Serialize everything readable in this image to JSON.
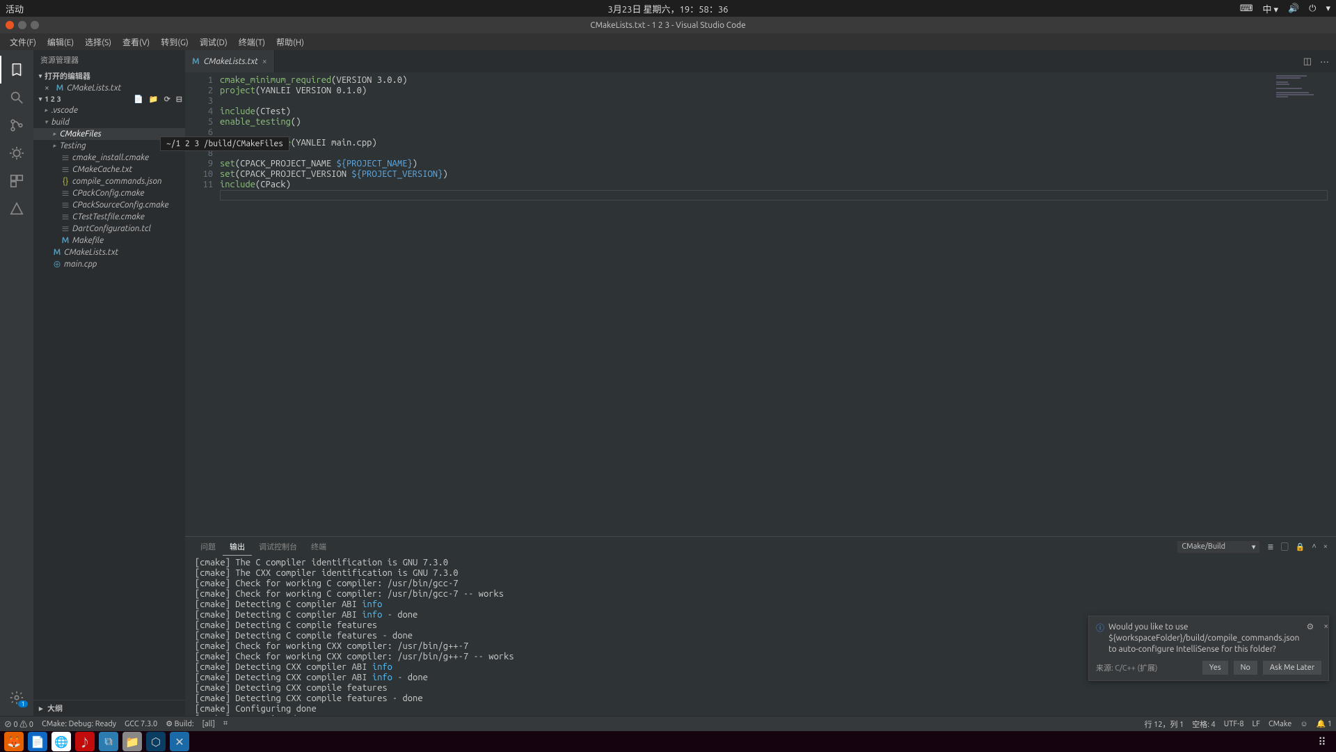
{
  "system": {
    "activities": "活动",
    "datetime": "3月23日 星期六，19：58：36",
    "ime": "中 ▾"
  },
  "window": {
    "title": "CMakeLists.txt - 1 2 3 - Visual Studio Code"
  },
  "menubar": [
    "文件(F)",
    "编辑(E)",
    "选择(S)",
    "查看(V)",
    "转到(G)",
    "调试(D)",
    "终端(T)",
    "帮助(H)"
  ],
  "sidebar": {
    "title": "资源管理器",
    "openEditorsLabel": "打开的编辑器",
    "openEditors": [
      {
        "icon": "M",
        "name": "CMakeLists.txt"
      }
    ],
    "projectLabel": "1 2 3",
    "tree": [
      {
        "depth": 0,
        "chevron": "▸",
        "icon": "folder",
        "label": ".vscode"
      },
      {
        "depth": 0,
        "chevron": "▾",
        "icon": "folder",
        "label": "build"
      },
      {
        "depth": 1,
        "chevron": "▸",
        "icon": "folder",
        "label": "CMakeFiles",
        "selected": true
      },
      {
        "depth": 1,
        "chevron": "▸",
        "icon": "folder",
        "label": "Testing"
      },
      {
        "depth": 1,
        "chevron": "",
        "icon": "file",
        "label": "cmake_install.cmake"
      },
      {
        "depth": 1,
        "chevron": "",
        "icon": "file",
        "label": "CMakeCache.txt"
      },
      {
        "depth": 1,
        "chevron": "",
        "icon": "json",
        "label": "compile_commands.json"
      },
      {
        "depth": 1,
        "chevron": "",
        "icon": "file",
        "label": "CPackConfig.cmake"
      },
      {
        "depth": 1,
        "chevron": "",
        "icon": "file",
        "label": "CPackSourceConfig.cmake"
      },
      {
        "depth": 1,
        "chevron": "",
        "icon": "file",
        "label": "CTestTestfile.cmake"
      },
      {
        "depth": 1,
        "chevron": "",
        "icon": "file",
        "label": "DartConfiguration.tcl"
      },
      {
        "depth": 1,
        "chevron": "",
        "icon": "M",
        "label": "Makefile"
      },
      {
        "depth": 0,
        "chevron": "",
        "icon": "M",
        "label": "CMakeLists.txt"
      },
      {
        "depth": 0,
        "chevron": "",
        "icon": "cpp",
        "label": "main.cpp"
      }
    ],
    "outlineLabel": "大纲"
  },
  "tooltip": "~/1 2 3 /build/CMakeFiles",
  "tab": {
    "icon": "M",
    "label": "CMakeLists.txt"
  },
  "code": {
    "lines": [
      [
        [
          "fn",
          "cmake_minimum_required"
        ],
        [
          "",
          "(VERSION 3.0.0)"
        ]
      ],
      [
        [
          "fn",
          "project"
        ],
        [
          "",
          "(YANLEI VERSION 0.1.0)"
        ]
      ],
      [
        [
          "",
          ""
        ]
      ],
      [
        [
          "fn",
          "include"
        ],
        [
          "",
          "(CTest)"
        ]
      ],
      [
        [
          "fn",
          "enable_testing"
        ],
        [
          "",
          "()"
        ]
      ],
      [
        [
          "",
          ""
        ]
      ],
      [
        [
          "fn",
          "add_executable"
        ],
        [
          "",
          "(YANLEI main.cpp)"
        ]
      ],
      [
        [
          "",
          ""
        ]
      ],
      [
        [
          "fn",
          "set"
        ],
        [
          "",
          "(CPACK_PROJECT_NAME "
        ],
        [
          "var",
          "${PROJECT_NAME}"
        ],
        [
          "",
          ")"
        ]
      ],
      [
        [
          "fn",
          "set"
        ],
        [
          "",
          "(CPACK_PROJECT_VERSION "
        ],
        [
          "var",
          "${PROJECT_VERSION}"
        ],
        [
          "",
          ")"
        ]
      ],
      [
        [
          "fn",
          "include"
        ],
        [
          "",
          "(CPack)"
        ]
      ]
    ],
    "total": 11
  },
  "panel": {
    "tabs": [
      "问题",
      "输出",
      "调试控制台",
      "终端"
    ],
    "active": 1,
    "dropdown": "CMake/Build",
    "output": [
      [
        [
          "",
          "[cmake] The C compiler identification is GNU 7.3.0"
        ]
      ],
      [
        [
          "",
          "[cmake] The CXX compiler identification is GNU 7.3.0"
        ]
      ],
      [
        [
          "",
          "[cmake] Check for working C compiler: /usr/bin/gcc-7"
        ]
      ],
      [
        [
          "",
          "[cmake] Check for working C compiler: /usr/bin/gcc-7 -- works"
        ]
      ],
      [
        [
          "",
          "[cmake] Detecting C compiler ABI "
        ],
        [
          "info",
          "info"
        ]
      ],
      [
        [
          "",
          "[cmake] Detecting C compiler ABI "
        ],
        [
          "info",
          "info"
        ],
        [
          "",
          " - done"
        ]
      ],
      [
        [
          "",
          "[cmake] Detecting C compile features"
        ]
      ],
      [
        [
          "",
          "[cmake] Detecting C compile features - done"
        ]
      ],
      [
        [
          "",
          "[cmake] Check for working CXX compiler: /usr/bin/g++-7"
        ]
      ],
      [
        [
          "",
          "[cmake] Check for working CXX compiler: /usr/bin/g++-7 -- works"
        ]
      ],
      [
        [
          "",
          "[cmake] Detecting CXX compiler ABI "
        ],
        [
          "info",
          "info"
        ]
      ],
      [
        [
          "",
          "[cmake] Detecting CXX compiler ABI "
        ],
        [
          "info",
          "info"
        ],
        [
          "",
          " - done"
        ]
      ],
      [
        [
          "",
          "[cmake] Detecting CXX compile features"
        ]
      ],
      [
        [
          "",
          "[cmake] Detecting CXX compile features - done"
        ]
      ],
      [
        [
          "",
          "[cmake] Configuring done"
        ]
      ],
      [
        [
          "",
          "[cmake] Generating done"
        ]
      ]
    ]
  },
  "notification": {
    "message": "Would you like to use ${workspaceFolder}/build/compile_commands.json to auto-configure IntelliSense for this folder?",
    "source": "来源: C/C++ (扩展)",
    "buttons": [
      "Yes",
      "No",
      "Ask Me Later"
    ]
  },
  "status": {
    "left": [
      "⊘ 0 ⚠ 0",
      "CMake: Debug: Ready",
      "GCC 7.3.0",
      "⚙ Build:",
      "[all]",
      "⌗"
    ],
    "right": [
      "行 12，列 1",
      "空格: 4",
      "UTF-8",
      "LF",
      "CMake",
      "☺",
      "🔔 1"
    ]
  },
  "gear_badge": "1"
}
